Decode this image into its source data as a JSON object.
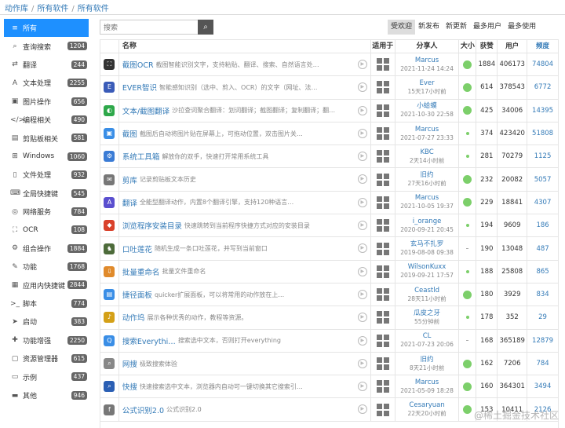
{
  "breadcrumb": [
    "动作库",
    "所有软件",
    "所有软件"
  ],
  "sidebar": [
    {
      "icon": "≡",
      "label": "所有",
      "badge": ""
    },
    {
      "icon": "⌕",
      "label": "查询搜索",
      "badge": "1204"
    },
    {
      "icon": "⇄",
      "label": "翻译",
      "badge": "244"
    },
    {
      "icon": "A",
      "label": "文本处理",
      "badge": "2255"
    },
    {
      "icon": "▣",
      "label": "图片操作",
      "badge": "656"
    },
    {
      "icon": "</>",
      "label": "编程相关",
      "badge": "490"
    },
    {
      "icon": "▤",
      "label": "剪贴板相关",
      "badge": "581"
    },
    {
      "icon": "⊞",
      "label": "Windows",
      "badge": "1060"
    },
    {
      "icon": "▯",
      "label": "文件处理",
      "badge": "932"
    },
    {
      "icon": "⌨",
      "label": "全局快捷键",
      "badge": "545"
    },
    {
      "icon": "◎",
      "label": "网络服务",
      "badge": "784"
    },
    {
      "icon": "⛶",
      "label": "OCR",
      "badge": "108"
    },
    {
      "icon": "⚙",
      "label": "组合操作",
      "badge": "1884"
    },
    {
      "icon": "✎",
      "label": "功能",
      "badge": "1768"
    },
    {
      "icon": "▦",
      "label": "应用内快捷键",
      "badge": "2844"
    },
    {
      "icon": ">_",
      "label": "脚本",
      "badge": "774"
    },
    {
      "icon": "➤",
      "label": "启动",
      "badge": "383"
    },
    {
      "icon": "✚",
      "label": "功能增强",
      "badge": "2250"
    },
    {
      "icon": "▢",
      "label": "资源管理器",
      "badge": "615"
    },
    {
      "icon": "▭",
      "label": "示例",
      "badge": "437"
    },
    {
      "icon": "▬",
      "label": "其他",
      "badge": "946"
    }
  ],
  "search": {
    "placeholder": "搜索",
    "button_icon": "search-icon"
  },
  "sort_tabs": [
    "受欢迎",
    "新发布",
    "新更新",
    "最多用户",
    "最多使用"
  ],
  "columns": [
    "名称",
    "适用于",
    "分享人",
    "大小",
    "获赞",
    "用户",
    "频度"
  ],
  "rows": [
    {
      "icon": "⛶",
      "color": "#333333",
      "name": "截图OCR",
      "desc": "截图智能识别文字，支持粘贴、翻译、搜索、自然语言处…",
      "sharer": "Marcus",
      "time": "2021-11-24 14:24",
      "size": "big",
      "likes": "1884",
      "users": "406173",
      "freq": "74804"
    },
    {
      "icon": "E",
      "color": "#3a5bb8",
      "name": "EVER智识",
      "desc": "智能感知识别（选中、剪入、OCR）的文字（网址、法…",
      "sharer": "Ever",
      "time": "15天17小时前",
      "size": "big",
      "likes": "614",
      "users": "378543",
      "freq": "6772"
    },
    {
      "icon": "◐",
      "color": "#2ea84a",
      "name": "文本/截图翻译",
      "desc": "沙拉查词聚合翻译：划词翻译；截图翻译；复制翻译；翻…",
      "sharer": "小蛤蟆",
      "time": "2021-10-30 22:58",
      "size": "big",
      "likes": "425",
      "users": "34006",
      "freq": "14395"
    },
    {
      "icon": "▣",
      "color": "#3a8ee6",
      "name": "截图",
      "desc": "截图后自动将图片贴在屏幕上，可拖动位置，双击图片关…",
      "sharer": "Marcus",
      "time": "2021-07-27 23:33",
      "size": "small",
      "likes": "374",
      "users": "423420",
      "freq": "51808"
    },
    {
      "icon": "⚙",
      "color": "#3a7bd5",
      "name": "系统工具箱",
      "desc": "解放你的双手，快速打开常用系统工具",
      "sharer": "KBC",
      "time": "2天14小时前",
      "size": "small",
      "likes": "281",
      "users": "70279",
      "freq": "1125"
    },
    {
      "icon": "✉",
      "color": "#777777",
      "name": "剪库",
      "desc": "记录剪贴板文本历史",
      "sharer": "旧约",
      "time": "27天16小时前",
      "size": "big",
      "likes": "232",
      "users": "20082",
      "freq": "5057"
    },
    {
      "icon": "A",
      "color": "#5a4fcf",
      "name": "翻译",
      "desc": "全能型翻译动作，内置8个翻译引擎，支持120种语言…",
      "sharer": "Marcus",
      "time": "2021-10-05 19:37",
      "size": "big",
      "likes": "229",
      "users": "18841",
      "freq": "4307"
    },
    {
      "icon": "◆",
      "color": "#d9412b",
      "name": "浏览程序安装目录",
      "desc": "快速跳转到当前程序快捷方式对应的安装目录",
      "sharer": "i_orange",
      "time": "2020-09-21 20:45",
      "size": "small",
      "likes": "194",
      "users": "9609",
      "freq": "186"
    },
    {
      "icon": "♞",
      "color": "#4d6b3a",
      "name": "口吐莲花",
      "desc": "随机生成一条口吐莲花，并写到当前窗口",
      "sharer": "玄马不扎罗",
      "time": "2019-08-08 09:38",
      "size": "dash",
      "likes": "190",
      "users": "13048",
      "freq": "487"
    },
    {
      "icon": "⇩",
      "color": "#e08a2b",
      "name": "批量重命名",
      "desc": "批量文件重命名",
      "sharer": "WilsonKuxx",
      "time": "2019-09-21 17:57",
      "size": "small",
      "likes": "188",
      "users": "25808",
      "freq": "865"
    },
    {
      "icon": "▤",
      "color": "#3a8ee6",
      "name": "捷径面板",
      "desc": "quicker扩展面板，可以将常用的动作放在上…",
      "sharer": "Ceastld",
      "time": "28天11小时前",
      "size": "big",
      "likes": "180",
      "users": "3929",
      "freq": "834"
    },
    {
      "icon": "♪",
      "color": "#d4a017",
      "name": "动作坞",
      "desc": "展示各种优秀的动作，教程等资源。",
      "sharer": "瓜皮之牙",
      "time": "55分钟前",
      "size": "small",
      "likes": "178",
      "users": "352",
      "freq": "29"
    },
    {
      "icon": "Q",
      "color": "#3a8ee6",
      "name": "搜索Everythi…",
      "desc": "搜索选中文本，否则打开everything",
      "sharer": "CL",
      "time": "2021-07-23 20:06",
      "size": "dash",
      "likes": "168",
      "users": "365189",
      "freq": "12879"
    },
    {
      "icon": "⌕",
      "color": "#888888",
      "name": "网搜",
      "desc": "极致搜索体验",
      "sharer": "旧约",
      "time": "8天21小时前",
      "size": "big",
      "likes": "162",
      "users": "7206",
      "freq": "784"
    },
    {
      "icon": "⌕",
      "color": "#2b5fb4",
      "name": "快搜",
      "desc": "快速搜索选中文本，浏览器内自动可一键切换其它搜索引…",
      "sharer": "Marcus",
      "time": "2021-05-09 18:28",
      "size": "big",
      "likes": "160",
      "users": "364301",
      "freq": "3494"
    },
    {
      "icon": "f",
      "color": "#777777",
      "name": "公式识别2.0",
      "desc": "公式识别2.0",
      "sharer": "Cesaryuan",
      "time": "22天20小时前",
      "size": "big",
      "likes": "153",
      "users": "10411",
      "freq": "2126"
    }
  ],
  "watermark": "@稀土掘金技术社区"
}
